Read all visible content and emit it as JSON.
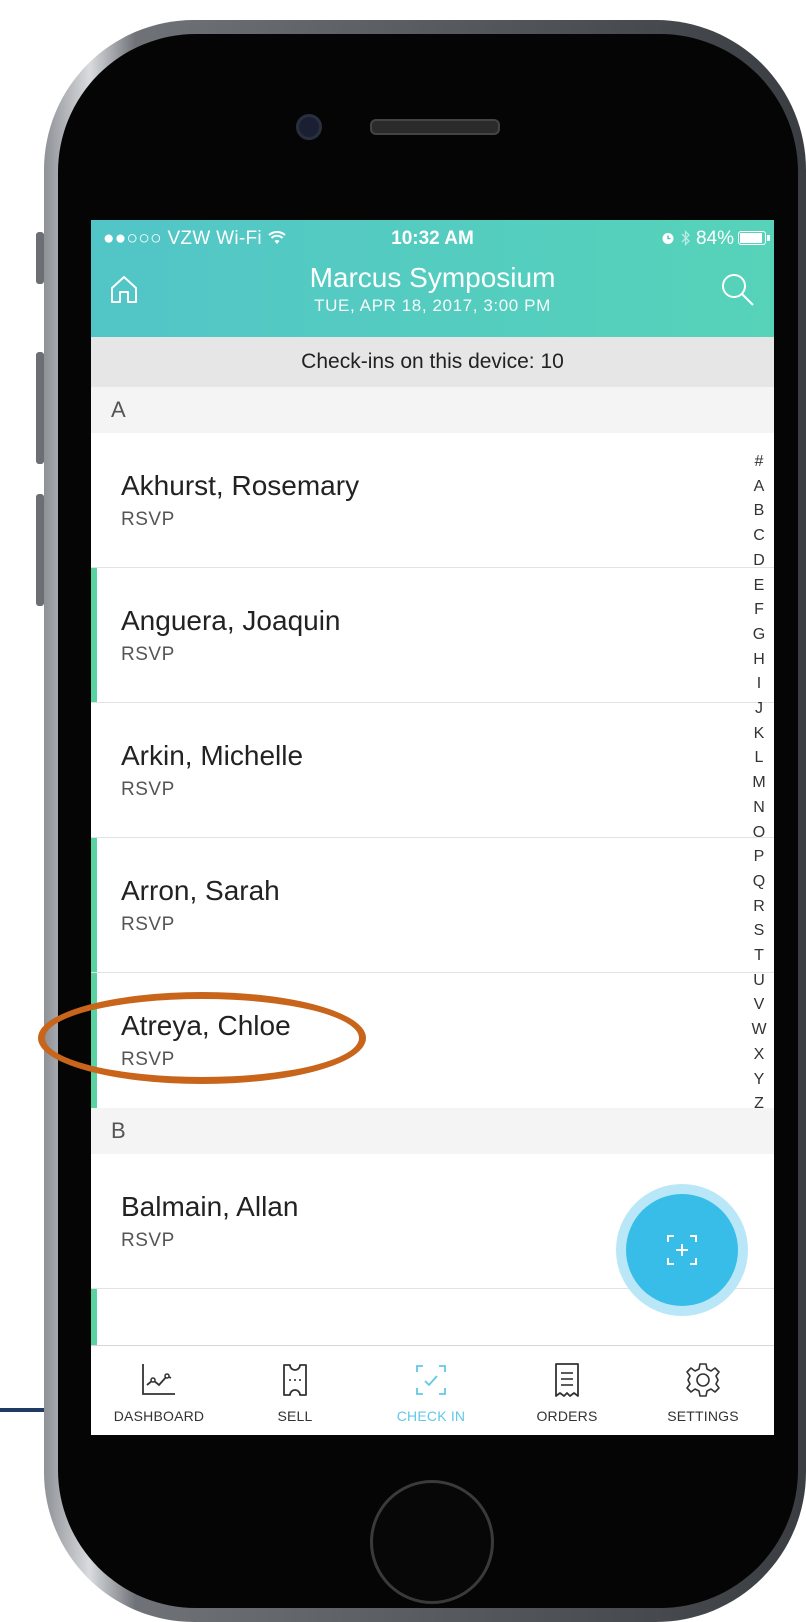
{
  "status_bar": {
    "carrier": "●●○○○ VZW Wi-Fi",
    "time": "10:32 AM",
    "battery": "84%",
    "battery_level": 0.84
  },
  "header": {
    "title": "Marcus Symposium",
    "subtitle": "TUE, APR 18, 2017, 3:00 PM"
  },
  "checkins_text": "Check-ins on this device: 10",
  "sections": [
    {
      "letter": "A",
      "rows": [
        {
          "name": "Akhurst, Rosemary",
          "type": "RSVP",
          "checked_in": false
        },
        {
          "name": "Anguera, Joaquin",
          "type": "RSVP",
          "checked_in": true
        },
        {
          "name": "Arkin, Michelle",
          "type": "RSVP",
          "checked_in": false
        },
        {
          "name": "Arron, Sarah",
          "type": "RSVP",
          "checked_in": true
        },
        {
          "name": "Atreya, Chloe",
          "type": "RSVP",
          "checked_in": true
        }
      ]
    },
    {
      "letter": "B",
      "rows": [
        {
          "name": "Balmain, Allan",
          "type": "RSVP",
          "checked_in": false
        }
      ]
    }
  ],
  "alpha_index": [
    "#",
    "A",
    "B",
    "C",
    "D",
    "E",
    "F",
    "G",
    "H",
    "I",
    "J",
    "K",
    "L",
    "M",
    "N",
    "O",
    "P",
    "Q",
    "R",
    "S",
    "T",
    "U",
    "V",
    "W",
    "X",
    "Y",
    "Z"
  ],
  "tabs": [
    {
      "label": "DASHBOARD",
      "icon": "dashboard-chart-icon",
      "active": false
    },
    {
      "label": "SELL",
      "icon": "ticket-icon",
      "active": false
    },
    {
      "label": "CHECK IN",
      "icon": "check-in-scan-icon",
      "active": true
    },
    {
      "label": "ORDERS",
      "icon": "receipt-icon",
      "active": false
    },
    {
      "label": "SETTINGS",
      "icon": "gear-icon",
      "active": false
    }
  ],
  "colors": {
    "header_start": "#52c5c7",
    "header_end": "#56d3b9",
    "checked_bar": "#58d3a1",
    "fab": "#38bde8",
    "active_tab": "#64c7e6",
    "annotation": "#c8651b"
  }
}
